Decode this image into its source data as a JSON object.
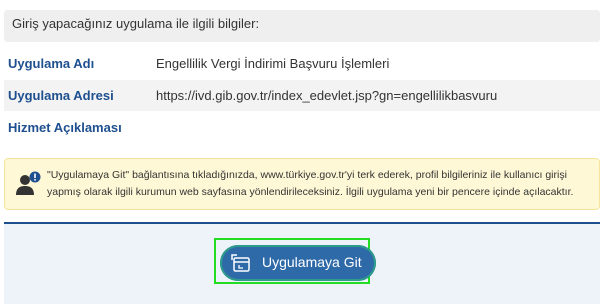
{
  "header": {
    "title": "Giriş yapacağınız uygulama ile ilgili bilgiler:"
  },
  "info_rows": [
    {
      "label": "Uygulama Adı",
      "value": "Engellilik Vergi İndirimi Başvuru İşlemleri"
    },
    {
      "label": "Uygulama Adresi",
      "value": "https://ivd.gib.gov.tr/index_edevlet.jsp?gn=engellilikbasvuru"
    },
    {
      "label": "Hizmet Açıklaması",
      "value": ""
    }
  ],
  "notice": {
    "icon": "user-info-icon",
    "text": "\"Uygulamaya Git\" bağlantısına tıkladığınızda, www.türkiye.gov.tr'yi terk ederek, profil bilgileriniz ile kullanıcı girişi yapmış olarak ilgili kurumun web sayfasına yönlendirileceksiniz. İlgili uygulama yeni bir pencere içinde açılacaktır."
  },
  "action": {
    "button_label": "Uygulamaya Git",
    "icon": "external-window-icon"
  },
  "colors": {
    "label_blue": "#1e4f8f",
    "button_blue": "#2f6aa8",
    "highlight_green": "#22dd22",
    "notice_bg": "#fff8d6"
  }
}
